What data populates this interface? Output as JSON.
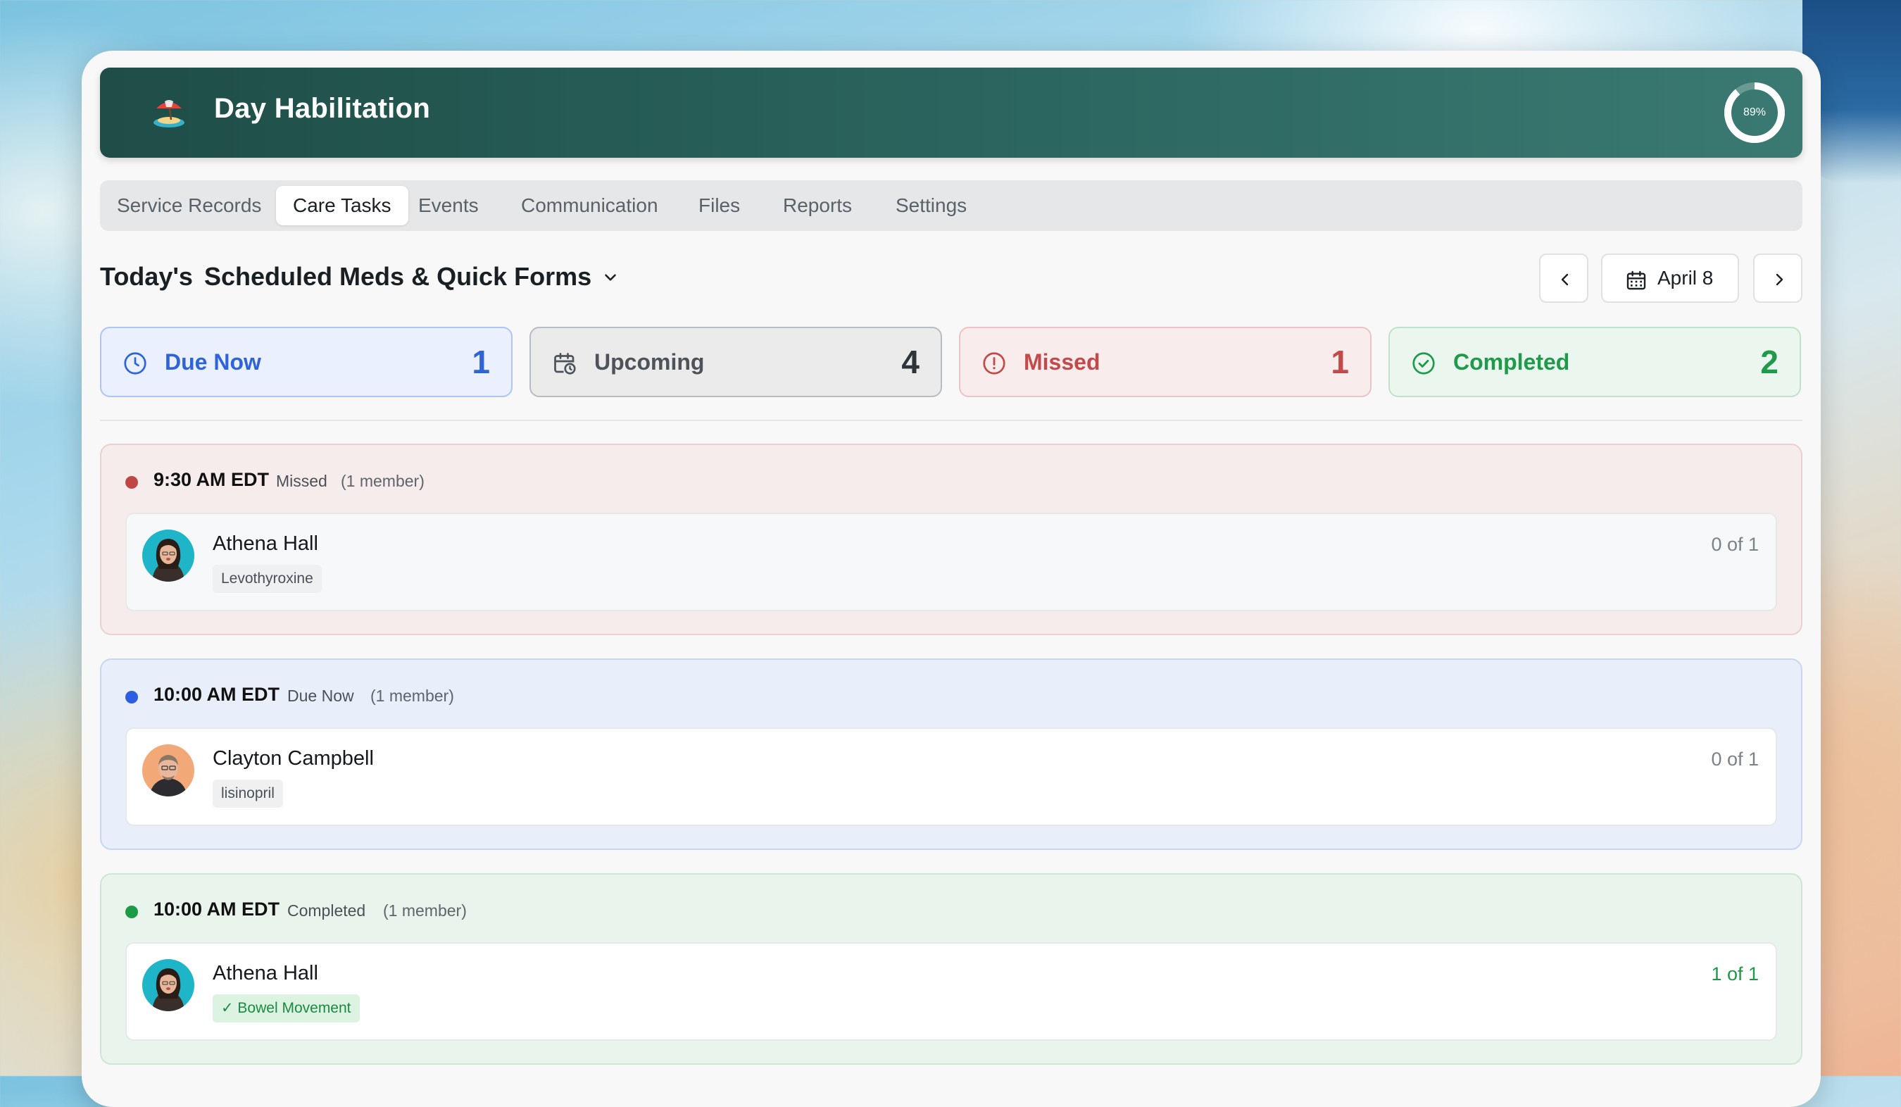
{
  "app": {
    "title": "Day Habilitation",
    "progress": {
      "percent": 89,
      "label": "89%"
    }
  },
  "tabs": [
    {
      "label": "Service Records",
      "active": false
    },
    {
      "label": "Care Tasks",
      "active": true
    },
    {
      "label": "Events",
      "active": false
    },
    {
      "label": "Communication",
      "active": false
    },
    {
      "label": "Files",
      "active": false
    },
    {
      "label": "Reports",
      "active": false
    },
    {
      "label": "Settings",
      "active": false
    }
  ],
  "section": {
    "prefix": "Today's",
    "selected": "Scheduled Meds & Quick Forms"
  },
  "date_nav": {
    "date": "April 8",
    "prev_icon": "chevron-left-icon",
    "next_icon": "chevron-right-icon"
  },
  "stats": {
    "due_now": {
      "label": "Due Now",
      "count": "1",
      "color": "#2f63d8",
      "icon": "clock-icon"
    },
    "upcoming": {
      "label": "Upcoming",
      "count": "4",
      "color": "#4d5359",
      "icon": "calendar-clock-icon"
    },
    "missed": {
      "label": "Missed",
      "count": "1",
      "color": "#c24a4a",
      "icon": "alert-circle-icon"
    },
    "completed": {
      "label": "Completed",
      "count": "2",
      "color": "#1f9a4a",
      "icon": "check-circle-icon"
    }
  },
  "groups": [
    {
      "time": "9:30 AM EDT",
      "status": "Missed",
      "members": "(1 member)",
      "entries": [
        {
          "name": "Athena Hall",
          "task": "Levothyroxine",
          "ratio": "0 of 1"
        }
      ]
    },
    {
      "time": "10:00 AM EDT",
      "status": "Due Now",
      "members": "(1 member)",
      "entries": [
        {
          "name": "Clayton Campbell",
          "task": "lisinopril",
          "ratio": "0 of 1"
        }
      ]
    },
    {
      "time": "10:00 AM EDT",
      "status": "Completed",
      "members": "(1 member)",
      "entries": [
        {
          "name": "Athena Hall",
          "task": "✓ Bowel Movement",
          "ratio": "1 of 1"
        }
      ]
    }
  ]
}
